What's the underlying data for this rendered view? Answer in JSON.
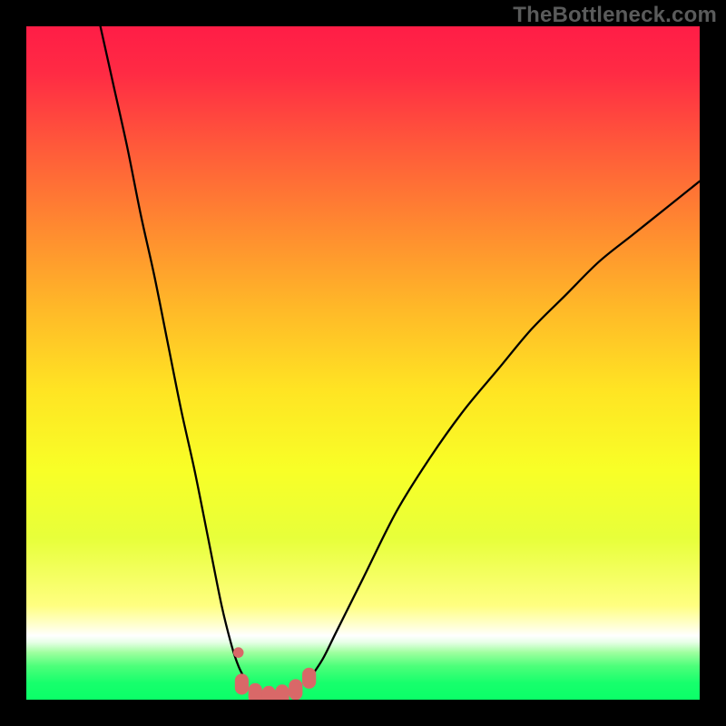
{
  "watermark": "TheBottleneck.com",
  "chart_data": {
    "type": "line",
    "title": "",
    "xlabel": "",
    "ylabel": "",
    "xlim": [
      0,
      100
    ],
    "ylim": [
      0,
      100
    ],
    "grid": false,
    "series": [
      {
        "name": "left-curve",
        "x": [
          11,
          13,
          15,
          17,
          19,
          21,
          23,
          25,
          27,
          29,
          30.5,
          31.5,
          32.5
        ],
        "y": [
          100,
          91,
          82,
          72,
          63,
          53,
          43,
          34,
          24,
          14,
          8,
          5,
          3
        ]
      },
      {
        "name": "right-curve",
        "x": [
          42,
          44,
          46,
          50,
          55,
          60,
          65,
          70,
          75,
          80,
          85,
          90,
          95,
          100
        ],
        "y": [
          3,
          6,
          10,
          18,
          28,
          36,
          43,
          49,
          55,
          60,
          65,
          69,
          73,
          77
        ]
      }
    ],
    "markers": [
      {
        "name": "dot-a",
        "x": 31.5,
        "y": 7
      },
      {
        "name": "bar-b",
        "x": 32,
        "y": 2.3
      },
      {
        "name": "bar-c",
        "x": 34,
        "y": 0.9
      },
      {
        "name": "bar-d",
        "x": 36,
        "y": 0.5
      },
      {
        "name": "bar-e",
        "x": 38,
        "y": 0.7
      },
      {
        "name": "bar-f",
        "x": 40,
        "y": 1.5
      },
      {
        "name": "bar-g",
        "x": 42,
        "y": 3.2
      }
    ],
    "gradient_stops": [
      {
        "offset": 0.0,
        "color": "#ff1d46"
      },
      {
        "offset": 0.07,
        "color": "#ff2b44"
      },
      {
        "offset": 0.18,
        "color": "#ff5a3a"
      },
      {
        "offset": 0.3,
        "color": "#ff8a30"
      },
      {
        "offset": 0.42,
        "color": "#ffb928"
      },
      {
        "offset": 0.54,
        "color": "#ffe423"
      },
      {
        "offset": 0.66,
        "color": "#f8ff27"
      },
      {
        "offset": 0.76,
        "color": "#e7ff3a"
      },
      {
        "offset": 0.86,
        "color": "#ffff80"
      },
      {
        "offset": 0.885,
        "color": "#ffffc4"
      },
      {
        "offset": 0.905,
        "color": "#ffffff"
      },
      {
        "offset": 0.915,
        "color": "#e6ffe6"
      },
      {
        "offset": 0.93,
        "color": "#9fff9f"
      },
      {
        "offset": 0.95,
        "color": "#4dff7a"
      },
      {
        "offset": 0.975,
        "color": "#17ff6c"
      },
      {
        "offset": 1.0,
        "color": "#0bff68"
      }
    ],
    "curve_stroke": "#000000",
    "curve_stroke_width": 2.3,
    "marker_color": "#d96868",
    "marker_radius": 10.5
  }
}
